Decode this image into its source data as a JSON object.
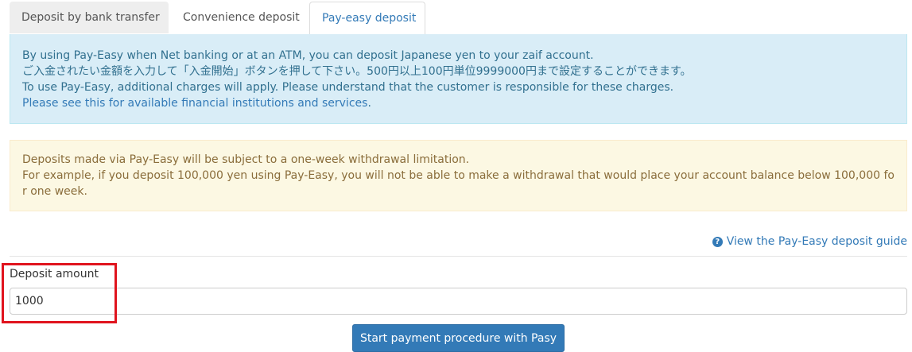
{
  "tabs": [
    {
      "label": "Deposit by bank transfer",
      "active": false
    },
    {
      "label": "Convenience deposit",
      "active": false
    },
    {
      "label": "Pay-easy deposit",
      "active": true
    }
  ],
  "info_alert": {
    "lines": [
      "By using Pay-Easy when Net banking or at an ATM, you can deposit Japanese yen to your zaif account.",
      "ご入金されたい金額を入力して「入金開始」ボタンを押して下さい。500円以上100円単位9999000円まで設定することができます。",
      "To use Pay-Easy, additional charges will apply. Please understand that the customer is responsible for these charges."
    ],
    "link_text": "Please see this for available financial institutions and services"
  },
  "warning_alert": {
    "line1": "Deposits made via Pay-Easy will be subject to a one-week withdrawal limitation.",
    "line2": "For example, if you deposit 100,000 yen using Pay-Easy, you will not be able to make a withdrawal that would place your account balance below 100,000 for one week."
  },
  "guide_link": {
    "label": "View the Pay-Easy deposit guide",
    "icon": "question-circle-icon"
  },
  "deposit_form": {
    "label": "Deposit amount",
    "value": "1000"
  },
  "start_button": {
    "label": "Start payment procedure with Pasy"
  },
  "colors": {
    "accent": "#337ab7",
    "highlight": "#e0141e",
    "info_bg": "#d9edf7",
    "warning_bg": "#fcf8e3"
  }
}
